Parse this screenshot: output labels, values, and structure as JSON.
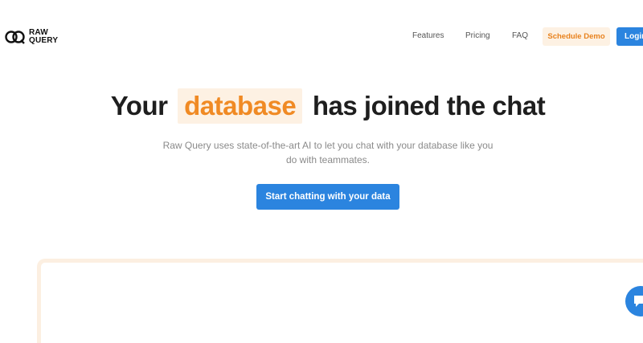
{
  "header": {
    "logo": {
      "line1": "RAW",
      "line2": "QUERY"
    },
    "nav": {
      "features": "Features",
      "pricing": "Pricing",
      "faq": "FAQ"
    },
    "schedule_demo": "Schedule Demo",
    "login": "Login"
  },
  "hero": {
    "title_before": "Your",
    "title_highlight": "database",
    "title_after": "has joined the chat",
    "subtitle": "Raw Query uses state-of-the-art AI to let you chat with your database like you do with teammates.",
    "cta": "Start chatting with your data"
  },
  "colors": {
    "accent_blue": "#2b84df",
    "accent_orange": "#f08a24",
    "highlight_bg": "#fdf1e3"
  },
  "icons": {
    "logo": "raw-query-logo-icon",
    "chat": "chat-bubble-icon"
  }
}
